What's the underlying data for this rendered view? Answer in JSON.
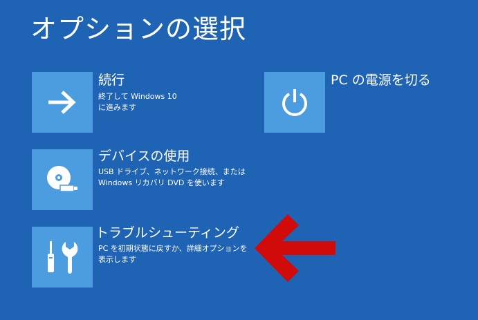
{
  "page": {
    "title": "オプションの選択"
  },
  "options": {
    "continue": {
      "title": "続行",
      "desc_line1": "終了して Windows 10",
      "desc_line2": "に進みます",
      "icon": "right-arrow-icon"
    },
    "use_device": {
      "title": "デバイスの使用",
      "desc_line1": "USB ドライブ、ネットワーク接続、または",
      "desc_line2": "Windows リカバリ DVD を使います",
      "icon": "disc-drive-icon"
    },
    "troubleshoot": {
      "title": "トラブルシューティング",
      "desc_line1": "PC を初期状態に戻すか、詳細オプションを",
      "desc_line2": "表示します",
      "icon": "tools-icon"
    },
    "power_off": {
      "title": "PC の電源を切る",
      "icon": "power-icon"
    }
  },
  "annotation": {
    "icon": "pointer-arrow-icon",
    "color": "#d10a0a"
  },
  "colors": {
    "background": "#1f63b5",
    "tile": "#4c9de0",
    "text": "#ffffff"
  }
}
